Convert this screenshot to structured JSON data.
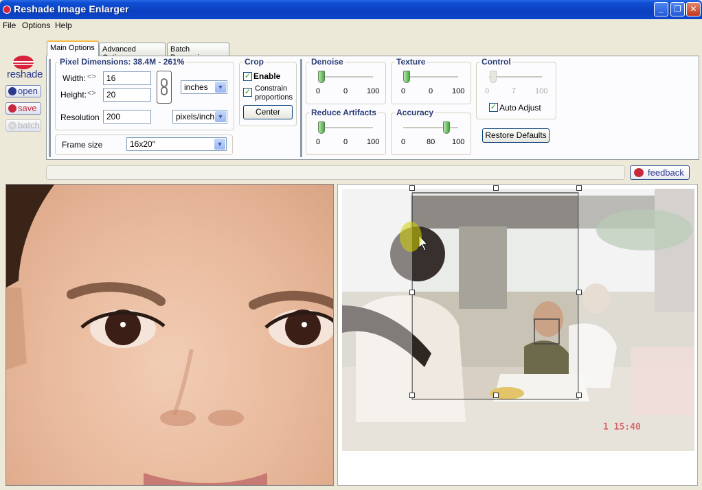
{
  "window": {
    "title": "Reshade Image Enlarger"
  },
  "menu": [
    "File",
    "Options",
    "Help"
  ],
  "brand": {
    "logo_text": "reshade",
    "accent": "#d8213a",
    "brand_blue": "#2d3a8c"
  },
  "sidebar": {
    "open_label": "open",
    "save_label": "save",
    "batch_label": "batch"
  },
  "tabs": [
    "Main Options",
    "Advanced Options",
    "Batch Processing"
  ],
  "pixel_dimensions": {
    "title": "Pixel Dimensions:",
    "summary": "38.4M - 261%",
    "width_label": "Width:",
    "width_value": "16",
    "height_label": "Height:",
    "height_value": "20",
    "unit": "inches",
    "resolution_label": "Resolution",
    "resolution_value": "200",
    "resolution_unit": "pixels/inch"
  },
  "frame": {
    "label": "Frame size",
    "value": "16x20\""
  },
  "crop": {
    "title": "Crop",
    "enable_label": "Enable",
    "enable_checked": true,
    "constrain_label_1": "Constrain",
    "constrain_label_2": "proportions",
    "constrain_checked": true,
    "center_label": "Center"
  },
  "sliders": {
    "denoise": {
      "title": "Denoise",
      "min": "0",
      "value": "0",
      "max": "100"
    },
    "texture": {
      "title": "Texture",
      "min": "0",
      "value": "0",
      "max": "100"
    },
    "control": {
      "title": "Control",
      "min": "0",
      "value": "7",
      "max": "100",
      "disabled": true
    },
    "reduce_artifacts": {
      "title": "Reduce Artifacts",
      "min": "0",
      "value": "0",
      "max": "100"
    },
    "accuracy": {
      "title": "Accuracy",
      "min": "0",
      "value": "80",
      "max": "100"
    }
  },
  "auto_adjust": {
    "label": "Auto Adjust",
    "checked": true
  },
  "restore_label": "Restore Defaults",
  "feedback_label": "feedback",
  "photo_timestamp": "1 15:40"
}
